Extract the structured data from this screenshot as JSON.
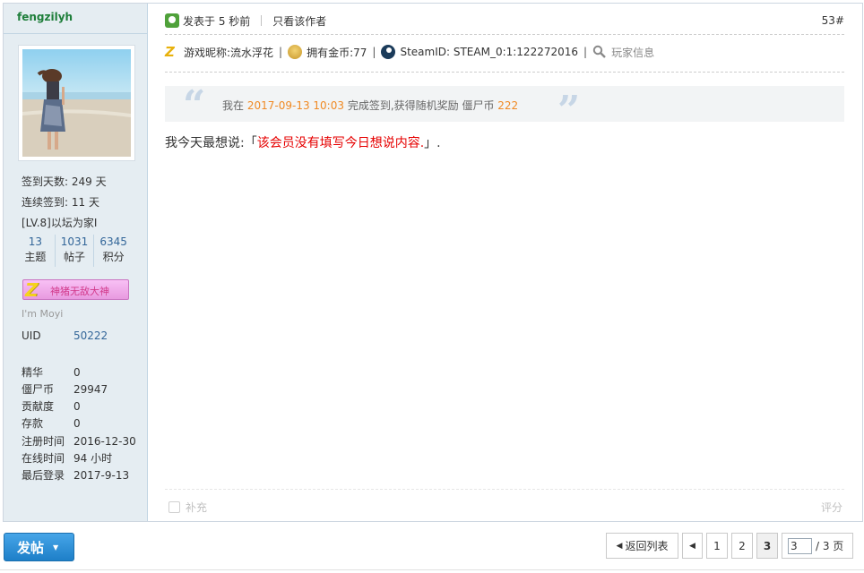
{
  "post": {
    "author": "fengzilyh",
    "posted_time": "发表于 5 秒前",
    "only_author": "只看该作者",
    "floor": "53#",
    "info": {
      "nickname": "游戏昵称:流水浮花",
      "coins": "拥有金币:77",
      "steam_id": "SteamID: STEAM_0:1:122272016",
      "player_info": "玩家信息"
    },
    "quote": {
      "prefix": "我在",
      "date": "2017-09-13 10:03",
      "middle": "完成签到,获得随机奖励 僵尸币",
      "reward": "222"
    },
    "content": {
      "prefix": "我今天最想说:「",
      "highlight": "该会员没有填写今日想说内容.",
      "suffix": "」."
    },
    "supplement": "补充",
    "rate": "评分"
  },
  "profile": {
    "checkin_days": "签到天数: 249 天",
    "streak": "连续签到: 11 天",
    "level": "[LV.8]以坛为家I",
    "counts": [
      {
        "num": "13",
        "label": "主题"
      },
      {
        "num": "1031",
        "label": "帖子"
      },
      {
        "num": "6345",
        "label": "积分"
      }
    ],
    "medal": "神猪无敌大神",
    "signature": "I'm Moyi",
    "uid_label": "UID",
    "uid": "50222",
    "fields": [
      {
        "k": "精华",
        "v": "0"
      },
      {
        "k": "僵尸币",
        "v": "29947"
      },
      {
        "k": "贡献度",
        "v": "0"
      },
      {
        "k": "存款",
        "v": "0"
      },
      {
        "k": "注册时间",
        "v": "2016-12-30"
      },
      {
        "k": "在线时间",
        "v": "94 小时"
      },
      {
        "k": "最后登录",
        "v": "2017-9-13"
      }
    ]
  },
  "toolbar": {
    "post_button": "发帖",
    "back_to_list": "返回列表",
    "pages": [
      "1",
      "2",
      "3"
    ],
    "current_page": "3",
    "jump_value": "3",
    "total_pages": "/ 3 页"
  },
  "colors": {
    "author": "#1e7e3a",
    "link": "#336699",
    "orange": "#f08a24",
    "red": "#e60000",
    "button": "#1e7fc8"
  }
}
